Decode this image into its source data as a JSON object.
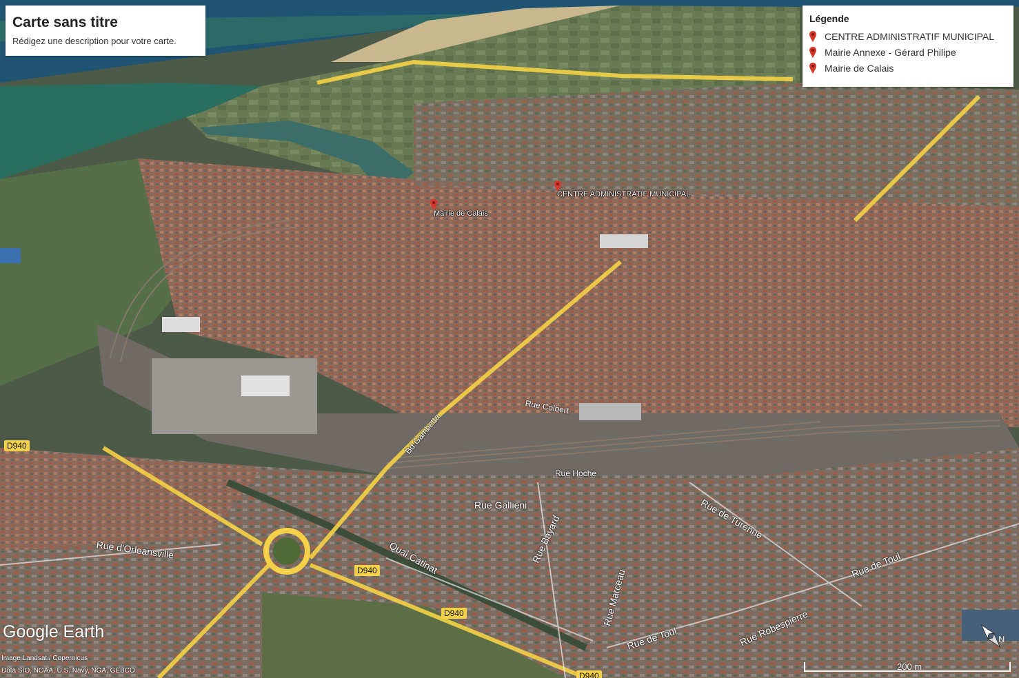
{
  "title_card": {
    "title": "Carte sans titre",
    "description": "Rédigez une description pour votre carte."
  },
  "legend": {
    "heading": "Légende",
    "items": [
      {
        "label": "CENTRE ADMINISTRATIF MUNICIPAL",
        "icon": "red-pin-icon"
      },
      {
        "label": "Mairie Annexe - Gérard Philipe",
        "icon": "red-pin-icon"
      },
      {
        "label": "Mairie de Calais",
        "icon": "red-pin-icon"
      }
    ]
  },
  "placemarks": {
    "centre": "CENTRE ADMINISTRATIF MUNICIPAL",
    "mairie": "Mairie de Calais"
  },
  "streets": {
    "orleansville": "Rue d'Orleansville",
    "catinat": "Quai Catinat",
    "gallieni": "Rue Gallieni",
    "bayard": "Rue Bayard",
    "marceau": "Rue Marceau",
    "toul1": "Rue de Toul",
    "toul2": "Rue de Toul",
    "robespierre": "Rue Robespierre",
    "turenne": "Rue de Turenne",
    "hoche": "Rue Hoche",
    "colbert": "Rue Colbert",
    "gambetta": "Bd Gambetta"
  },
  "routes": {
    "d940_a": "D940",
    "d940_b": "D940",
    "d940_c": "D940",
    "d940_d": "D940"
  },
  "branding": {
    "logo": "Google Earth",
    "image_credit": "Image Landsat / Copernicus",
    "data_credit": "Data SIO, NOAA, U.S. Navy, NGA, GEBCO"
  },
  "scale": {
    "label": "200 m"
  },
  "colors": {
    "pin": "#d6372b",
    "route": "#f4d146"
  }
}
